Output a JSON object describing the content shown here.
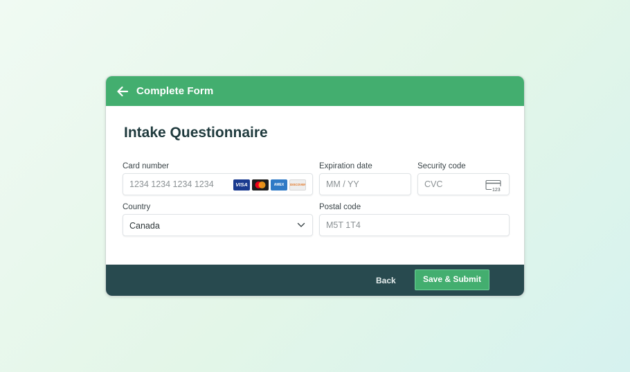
{
  "header": {
    "title": "Complete Form",
    "back_icon": "arrow-left-icon"
  },
  "form": {
    "title": "Intake Questionnaire",
    "card_number": {
      "label": "Card number",
      "placeholder": "1234 1234 1234 1234",
      "brands": [
        "VISA",
        "Mastercard",
        "AMEX",
        "DISCOVER"
      ]
    },
    "expiration": {
      "label": "Expiration date",
      "placeholder": "MM / YY"
    },
    "security_code": {
      "label": "Security code",
      "placeholder": "CVC",
      "icon_text": "123"
    },
    "country": {
      "label": "Country",
      "value": "Canada"
    },
    "postal_code": {
      "label": "Postal code",
      "placeholder": "M5T 1T4"
    }
  },
  "footer": {
    "back_label": "Back",
    "submit_label": "Save & Submit"
  },
  "colors": {
    "brand_green": "#43ae6f",
    "footer_bg": "#284a4f",
    "title_text": "#1f3a3d"
  }
}
